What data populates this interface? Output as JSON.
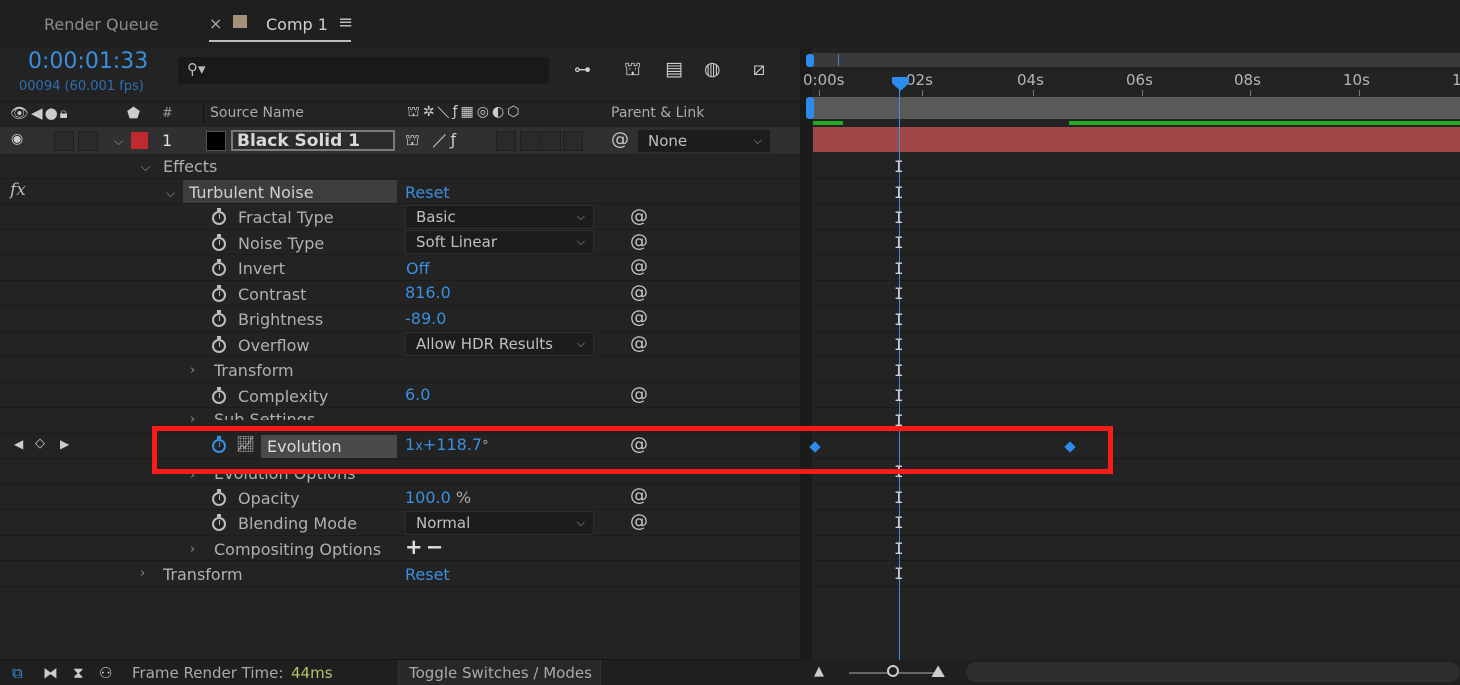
{
  "tabs": {
    "render_queue": "Render Queue",
    "close": "×",
    "comp": "Comp 1",
    "menu": "≡"
  },
  "timecode": {
    "current": "0:00:01:33",
    "frames": "00094 (60.001 fps)"
  },
  "search": {
    "placeholder": ""
  },
  "columns": {
    "hash": "#",
    "source_name": "Source Name",
    "parent_link": "Parent & Link"
  },
  "layer": {
    "number": "1",
    "name": "Black Solid 1",
    "parent": "None",
    "label_color": "#c0292e"
  },
  "tree": {
    "effects": "Effects",
    "fx_label": "fx",
    "effect_name": "Turbulent Noise",
    "reset": "Reset",
    "properties": {
      "fractal_type": {
        "name": "Fractal Type",
        "value": "Basic"
      },
      "noise_type": {
        "name": "Noise Type",
        "value": "Soft Linear"
      },
      "invert": {
        "name": "Invert",
        "value": "Off"
      },
      "contrast": {
        "name": "Contrast",
        "value": "816.0"
      },
      "brightness": {
        "name": "Brightness",
        "value": "-89.0"
      },
      "overflow": {
        "name": "Overflow",
        "value": "Allow HDR Results"
      },
      "transform_group": {
        "name": "Transform"
      },
      "complexity": {
        "name": "Complexity",
        "value": "6.0"
      },
      "sub_settings": {
        "name": "Sub Settings"
      },
      "evolution": {
        "name": "Evolution",
        "rev": "1",
        "x": "x",
        "deg": "+118.7",
        "unit": "°"
      },
      "evolution_options": {
        "name": "Evolution Options"
      },
      "opacity": {
        "name": "Opacity",
        "value": "100.0",
        "unit": "%"
      },
      "blending_mode": {
        "name": "Blending Mode",
        "value": "Normal"
      },
      "compositing_options": {
        "name": "Compositing Options",
        "value": "+−"
      }
    },
    "layer_transform": "Transform",
    "layer_transform_reset": "Reset"
  },
  "timeline": {
    "ticks": [
      "0:00s",
      "02s",
      "04s",
      "06s",
      "08s",
      "10s",
      "1"
    ],
    "ibeam": "I"
  },
  "bottom": {
    "frame_render_label": "Frame Render Time:",
    "frame_render_value": "44ms",
    "toggle": "Toggle Switches / Modes"
  },
  "colors": {
    "accent": "#3b8fe0",
    "highlight_box": "#ff1a1a",
    "layer_bar": "#a04748",
    "work_area_green": "#23a823"
  }
}
